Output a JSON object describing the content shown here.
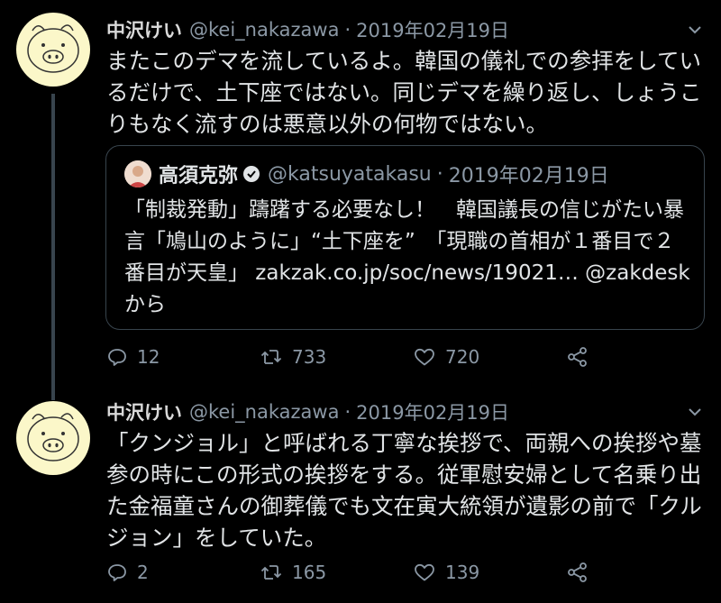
{
  "tweets": [
    {
      "name": "中沢けい",
      "handle": "@kei_nakazawa",
      "dot": "·",
      "date": "2019年02月19日",
      "text": "またこのデマを流しているよ。韓国の儀礼での参拝をしているだけで、土下座ではない。同じデマを繰り返し、しょうこりもなく流すのは悪意以外の何物ではない。",
      "quote": {
        "name": "高須克弥",
        "handle": "@katsuyatakasu",
        "dot": "·",
        "date": "2019年02月19日",
        "text": "「制裁発動」躊躇する必要なし！　韓国議長の信じがたい暴言「鳩山のように」“土下座を”　「現職の首相が１番目で２番目が天皇」 zakzak.co.jp/soc/news/19021… @zakdeskから"
      },
      "replies": "12",
      "retweets": "733",
      "likes": "720"
    },
    {
      "name": "中沢けい",
      "handle": "@kei_nakazawa",
      "dot": "·",
      "date": "2019年02月19日",
      "text": "「クンジョル」と呼ばれる丁寧な挨拶で、両親への挨拶や墓参の時にこの形式の挨拶をする。従軍慰安婦として名乗り出た金福童さんの御葬儀でも文在寅大統領が遺影の前で「クルジョン」をしていた。",
      "replies": "2",
      "retweets": "165",
      "likes": "139"
    }
  ],
  "icons": {
    "reply": "reply-icon",
    "retweet": "retweet-icon",
    "like": "heart-icon",
    "share": "share-icon",
    "verified": "verified-badge-icon",
    "caret": "chevron-down-icon"
  },
  "colors": {
    "background": "#000000",
    "text": "#e1e4e6",
    "muted": "#8b98a5",
    "border": "#38444d"
  }
}
